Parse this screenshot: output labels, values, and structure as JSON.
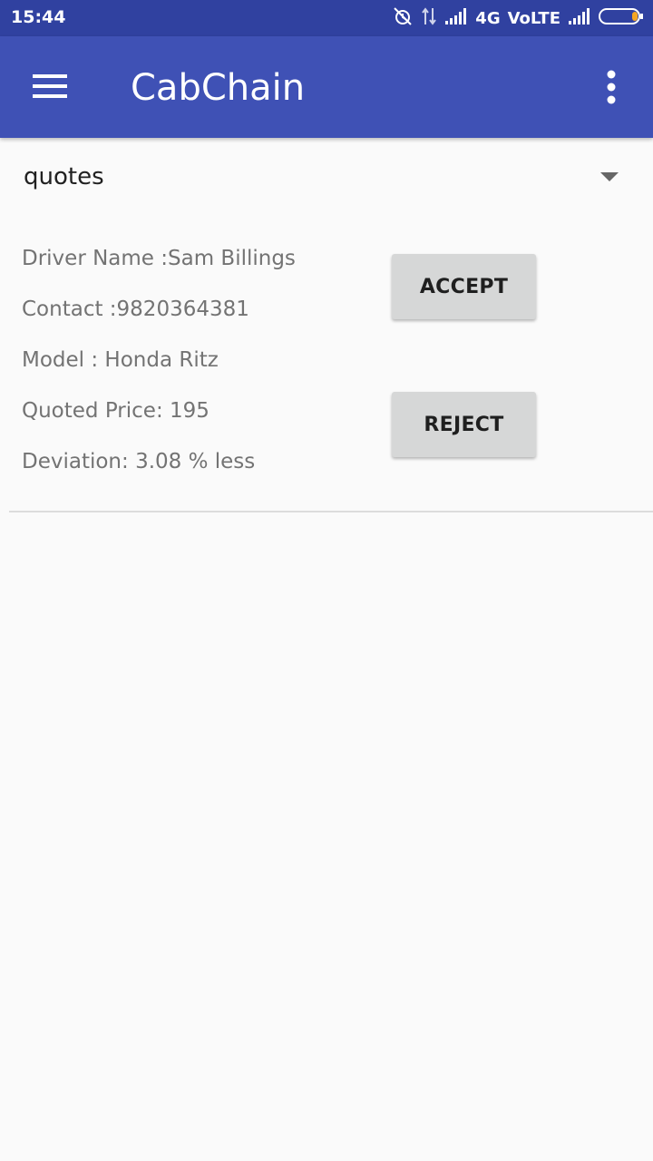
{
  "status_bar": {
    "time": "15:44",
    "network_label": "4G",
    "volte_label": "VoLTE",
    "icons": [
      "alarm-off-icon",
      "data-transfer-icon",
      "signal-icon",
      "signal-icon",
      "battery-icon"
    ],
    "battery_accent": "#f5a623"
  },
  "app_bar": {
    "title": "CabChain",
    "color": "#3f51b5",
    "icons": [
      "menu-icon",
      "more-vert-icon"
    ]
  },
  "spinner": {
    "selected": "quotes"
  },
  "quote": {
    "driver_name": "Driver Name :Sam Billings",
    "contact": "Contact :9820364381",
    "model": "Model : Honda Ritz",
    "quoted_price": "Quoted Price: 195",
    "deviation": "Deviation: 3.08 % less",
    "accept_label": "ACCEPT",
    "reject_label": "REJECT"
  }
}
